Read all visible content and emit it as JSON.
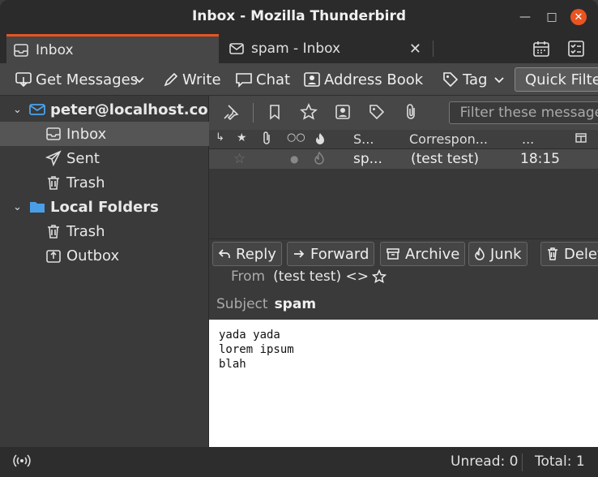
{
  "window": {
    "title": "Inbox - Mozilla Thunderbird"
  },
  "tabs": [
    {
      "label": "Inbox",
      "icon": "inbox-icon"
    },
    {
      "label": "spam - Inbox",
      "icon": "envelope-icon"
    }
  ],
  "toolbar": {
    "get_messages": "Get Messages",
    "write": "Write",
    "chat": "Chat",
    "address_book": "Address Book",
    "tag": "Tag",
    "quick_filter": "Quick Filter"
  },
  "folders": {
    "account": "peter@localhost.com",
    "inbox": "Inbox",
    "sent": "Sent",
    "trash": "Trash",
    "local_folders": "Local Folders",
    "local_trash": "Trash",
    "outbox": "Outbox"
  },
  "quickfilter": {
    "placeholder": "Filter these messages"
  },
  "columns": {
    "subject": "S...",
    "correspondents": "Correspon...",
    "date": "..."
  },
  "message_row": {
    "subject": "sp...",
    "correspondent": "(test test)",
    "time": "18:15"
  },
  "header_buttons": {
    "reply": "Reply",
    "forward": "Forward",
    "archive": "Archive",
    "junk": "Junk",
    "delete": "Delete"
  },
  "message": {
    "from_label": "From",
    "from_value": "(test test) <>",
    "subject_label": "Subject",
    "subject_value": "spam",
    "body_lines": [
      "yada yada",
      "lorem ipsum",
      "blah"
    ]
  },
  "status": {
    "unread": "Unread: 0",
    "total": "Total: 1"
  },
  "colors": {
    "accent": "#e95420",
    "folder_blue": "#4a9ee8",
    "envelope_blue": "#4aa3f0"
  }
}
